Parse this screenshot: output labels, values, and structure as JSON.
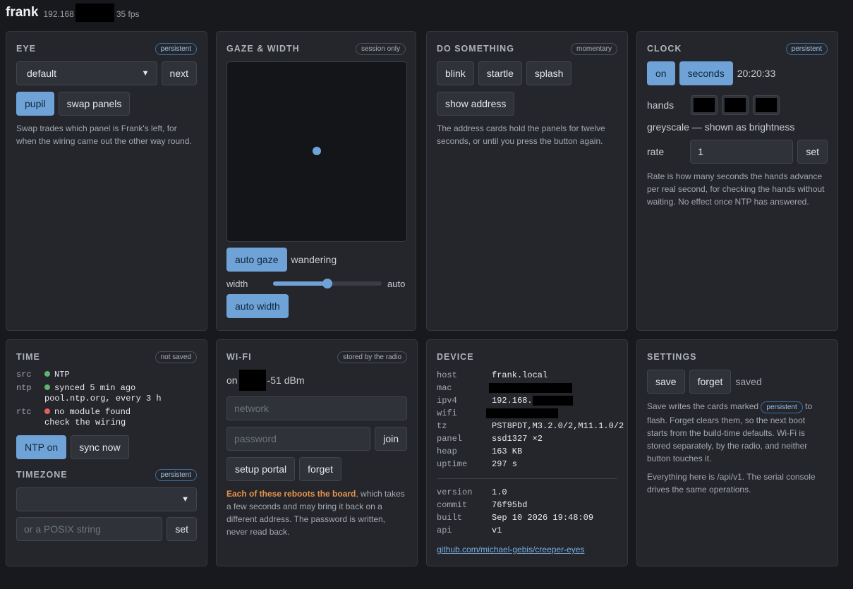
{
  "header": {
    "name": "frank",
    "ip_prefix": "192.168",
    "fps": "35 fps"
  },
  "eye": {
    "title": "EYE",
    "badge": "persistent",
    "select_value": "default",
    "next_label": "next",
    "pupil_label": "pupil",
    "swap_label": "swap panels",
    "note": "Swap trades which panel is Frank's left, for when the wiring came out the other way round."
  },
  "gaze": {
    "title": "GAZE & WIDTH",
    "badge": "session only",
    "auto_gaze_label": "auto gaze",
    "gaze_status": "wandering",
    "width_label": "width",
    "width_slider_value": 0.5,
    "width_value": "auto",
    "auto_width_label": "auto width"
  },
  "do": {
    "title": "DO SOMETHING",
    "badge": "momentary",
    "buttons": [
      "blink",
      "startle",
      "splash"
    ],
    "show_address_label": "show address",
    "note": "The address cards hold the panels for twelve seconds, or until you press the button again."
  },
  "clock": {
    "title": "CLOCK",
    "badge": "persistent",
    "on_label": "on",
    "seconds_label": "seconds",
    "time": "20:20:33",
    "hands_label": "hands",
    "hand_colors": [
      "#000000",
      "#000000",
      "#000000"
    ],
    "greyscale_note": "greyscale — shown as brightness",
    "rate_label": "rate",
    "rate_value": "1",
    "set_label": "set",
    "note": "Rate is how many seconds the hands advance per real second, for checking the hands without waiting. No effect once NTP has answered."
  },
  "time": {
    "title": "TIME",
    "badge": "not saved",
    "src_key": "src",
    "src_val": "NTP",
    "ntp_key": "ntp",
    "ntp_val1": "synced 5 min ago",
    "ntp_val2": "pool.ntp.org, every 3 h",
    "rtc_key": "rtc",
    "rtc_val1": "no module found",
    "rtc_val2": "check the wiring",
    "ntp_on_label": "NTP on",
    "sync_now_label": "sync now",
    "ok_color": "#5fb36b",
    "err_color": "#e0625a",
    "tz_title": "TIMEZONE",
    "tz_badge": "persistent",
    "tz_select_value": "",
    "posix_placeholder": "or a POSIX string",
    "set_label": "set"
  },
  "wifi": {
    "title": "WI-FI",
    "badge": "stored by the radio",
    "status_prefix": "on",
    "rssi": "-51 dBm",
    "network_placeholder": "network",
    "password_placeholder": "password",
    "join_label": "join",
    "portal_label": "setup portal",
    "forget_label": "forget",
    "note_highlight": "Each of these reboots the board",
    "note_rest": ", which takes a few seconds and may bring it back on a different address. The password is written, never read back.",
    "highlight_color": "#e8944a"
  },
  "device": {
    "title": "DEVICE",
    "host_k": "host",
    "host_v": "frank.local",
    "mac_k": "mac",
    "ipv4_k": "ipv4",
    "ipv4_v": "192.168.",
    "wifi_k": "wifi",
    "tz_k": "tz",
    "tz_v": "PST8PDT,M3.2.0/2,M11.1.0/2",
    "panel_k": "panel",
    "panel_v": "ssd1327 ×2",
    "heap_k": "heap",
    "heap_v": "163 KB",
    "uptime_k": "uptime",
    "uptime_v": "297 s",
    "version_k": "version",
    "version_v": "1.0",
    "commit_k": "commit",
    "commit_v": "76f95bd",
    "built_k": "built",
    "built_v": "Sep 10 2026 19:48:09",
    "api_k": "api",
    "api_v": "v1",
    "link": "github.com/michael-gebis/creeper-eyes"
  },
  "settings": {
    "title": "SETTINGS",
    "save_label": "save",
    "forget_label": "forget",
    "status": "saved",
    "note1_a": "Save writes the cards marked",
    "note1_pill": "persistent",
    "note1_b": "to flash. Forget clears them, so the next boot starts from the build-time defaults. Wi-Fi is stored separately, by the radio, and neither button touches it.",
    "note2": "Everything here is /api/v1. The serial console drives the same operations."
  }
}
